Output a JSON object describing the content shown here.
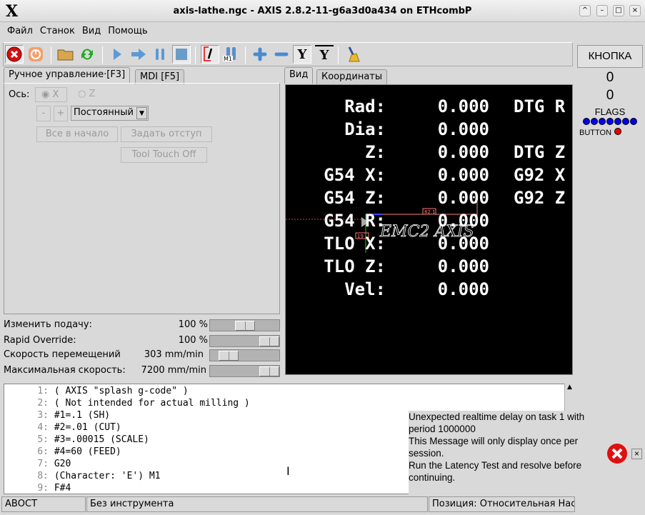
{
  "window": {
    "title": "axis-lathe.ngc - AXIS 2.8.2-11-g6a3d0a434 on ETHcombP",
    "logo": "X"
  },
  "menu": [
    "Файл",
    "Станок",
    "Вид",
    "Помощь"
  ],
  "toolbar": [
    {
      "name": "estop",
      "icon": "estop-icon"
    },
    {
      "name": "power",
      "icon": "power-icon"
    },
    {
      "name": "open",
      "icon": "folder-icon"
    },
    {
      "name": "reload",
      "icon": "reload-icon"
    },
    {
      "name": "run",
      "icon": "play-icon"
    },
    {
      "name": "step",
      "icon": "step-icon"
    },
    {
      "name": "pause",
      "icon": "pause-icon"
    },
    {
      "name": "stop",
      "icon": "stop-icon"
    },
    {
      "name": "block-delete",
      "icon": "block-delete-icon"
    },
    {
      "name": "optional-stop",
      "icon": "optional-stop-icon",
      "label": "M1"
    },
    {
      "name": "zoom-in",
      "icon": "plus-icon"
    },
    {
      "name": "zoom-out",
      "icon": "minus-icon"
    },
    {
      "name": "view-y",
      "icon": "view-y-icon",
      "label": "Y"
    },
    {
      "name": "view-y-rotated",
      "icon": "view-y2-icon",
      "label": "Y"
    },
    {
      "name": "clear-plot",
      "icon": "broom-icon"
    }
  ],
  "left_tabs": [
    "Ручное управление·[F3]",
    "MDI [F5]"
  ],
  "manual": {
    "axis_label": "Ось:",
    "axis_x": "X",
    "axis_z": "Z",
    "minus": "-",
    "plus": "+",
    "jog_mode": "Постоянный",
    "home_all": "Все в начало",
    "touch_off": "Задать отступ",
    "tool_touch_off": "Tool Touch Off"
  },
  "overrides": [
    {
      "label": "Изменить подачу:",
      "value": "100 %",
      "level": 0.5
    },
    {
      "label": "Rapid Override:",
      "value": "100 %",
      "level": 1.0
    },
    {
      "label": "Скорость перемещений",
      "value": "303 mm/min",
      "level": 0.2
    },
    {
      "label": "Максимальная скорость:",
      "value": "7200 mm/min",
      "level": 1.0
    }
  ],
  "right_tabs": [
    "Вид",
    "Координаты"
  ],
  "dro": {
    "left": [
      "Rad:",
      "Dia:",
      "Z:",
      "G54 X:",
      "G54 Z:",
      "G54 R:",
      "TLO X:",
      "TLO Z:",
      "Vel:"
    ],
    "values": [
      "0.000",
      "0.000",
      "0.000",
      "0.000",
      "0.000",
      "0.000",
      "0.000",
      "0.000",
      "0.000"
    ],
    "right": [
      "DTG R",
      "",
      "DTG Z",
      "G92 X",
      "G92 Z",
      "",
      "",
      "",
      ""
    ]
  },
  "preview": {
    "logo_text": "EMC2 AXIS",
    "dim1": "82.1",
    "dim2": "19"
  },
  "gcode": [
    {
      "n": "1:",
      "t": "( AXIS \"splash g-code\" )"
    },
    {
      "n": "2:",
      "t": "( Not intended for actual milling )"
    },
    {
      "n": "3:",
      "t": "#1=.1 (SH)"
    },
    {
      "n": "4:",
      "t": "#2=.01 (CUT)"
    },
    {
      "n": "5:",
      "t": "#3=.00015 (SCALE)"
    },
    {
      "n": "6:",
      "t": "#4=60 (FEED)"
    },
    {
      "n": "7:",
      "t": "G20"
    },
    {
      "n": "8:",
      "t": "(Character: 'E') M1"
    },
    {
      "n": "9:",
      "t": "F#4"
    }
  ],
  "status": {
    "state": "АВОСТ",
    "tool": "Без инструмента",
    "position": "Позиция: Относительная Нас"
  },
  "pyvcp": {
    "button": "КНОПКА",
    "value1": "0",
    "value2": "0",
    "flags_label": "FLAGS",
    "flags_count": 7,
    "button_label": "BUTTON",
    "flag_color": "#0000ee",
    "led_color": "#ee0000"
  },
  "notification": {
    "lines": [
      "Unexpected realtime delay on task 1 with",
      "period 1000000",
      "This Message will only display once per",
      "session.",
      "Run the Latency Test and resolve before",
      "continuing."
    ],
    "close": "×"
  }
}
